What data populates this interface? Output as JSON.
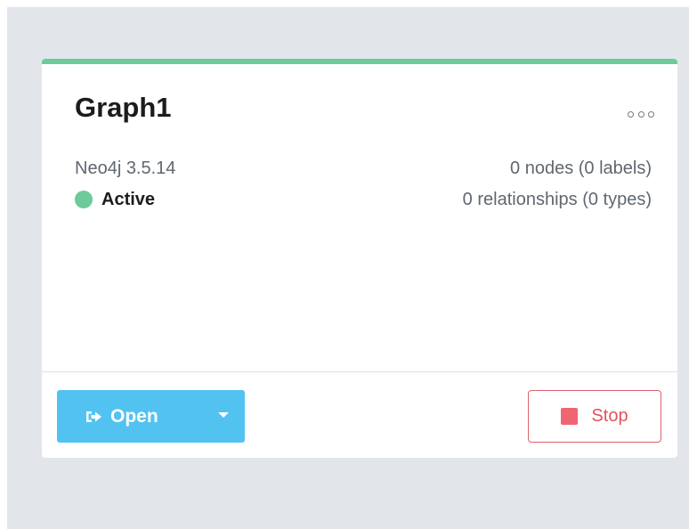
{
  "graph": {
    "name": "Graph1",
    "version": "Neo4j 3.5.14",
    "status": "Active",
    "nodes": "0 nodes (0 labels)",
    "relationships": "0 relationships (0 types)"
  },
  "actions": {
    "open_label": "Open",
    "stop_label": "Stop"
  },
  "icons": {
    "menu": "more-icon",
    "open": "open-external-icon",
    "dropdown": "caret-down-icon",
    "stop": "stop-square-icon",
    "status": "status-dot-icon"
  },
  "colors": {
    "active": "#6ccb98",
    "primary": "#52c3f1",
    "danger": "#e0545f",
    "backdrop": "#e2e6eb"
  }
}
